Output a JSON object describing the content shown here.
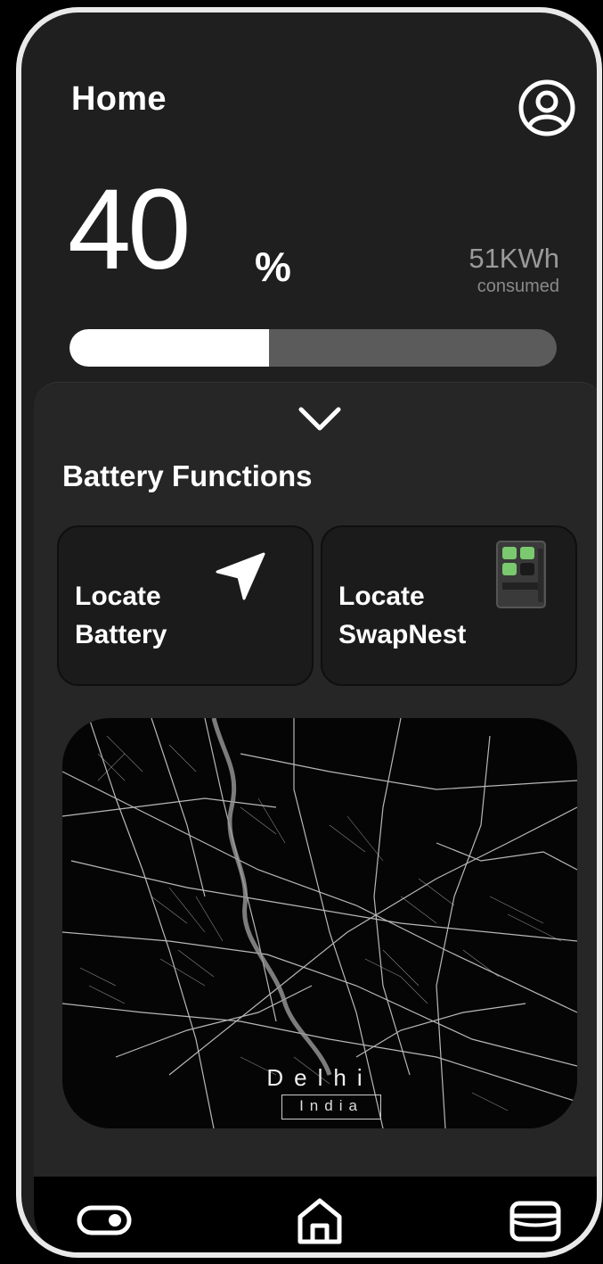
{
  "header": {
    "title": "Home"
  },
  "battery": {
    "percent_value": "40",
    "percent_sign": "%",
    "level": 0.41,
    "energy_value": "51KWh",
    "energy_label": "consumed"
  },
  "functions": {
    "title": "Battery Functions",
    "cards": [
      {
        "label_line1": "Locate",
        "label_line2": "Battery",
        "icon": "navigation-arrow-icon"
      },
      {
        "label_line1": "Locate",
        "label_line2": "SwapNest",
        "icon": "swapnest-station-icon"
      }
    ]
  },
  "map": {
    "city": "Delhi",
    "country": "India"
  },
  "bottom_nav": {
    "items": [
      "toggle-icon",
      "home-icon",
      "wallet-icon"
    ]
  },
  "colors": {
    "background": "#1f1f1f",
    "panel": "#262626",
    "progress_track": "#5b5b5b",
    "progress_fill": "#ffffff",
    "muted_text": "#9a9a9a"
  }
}
